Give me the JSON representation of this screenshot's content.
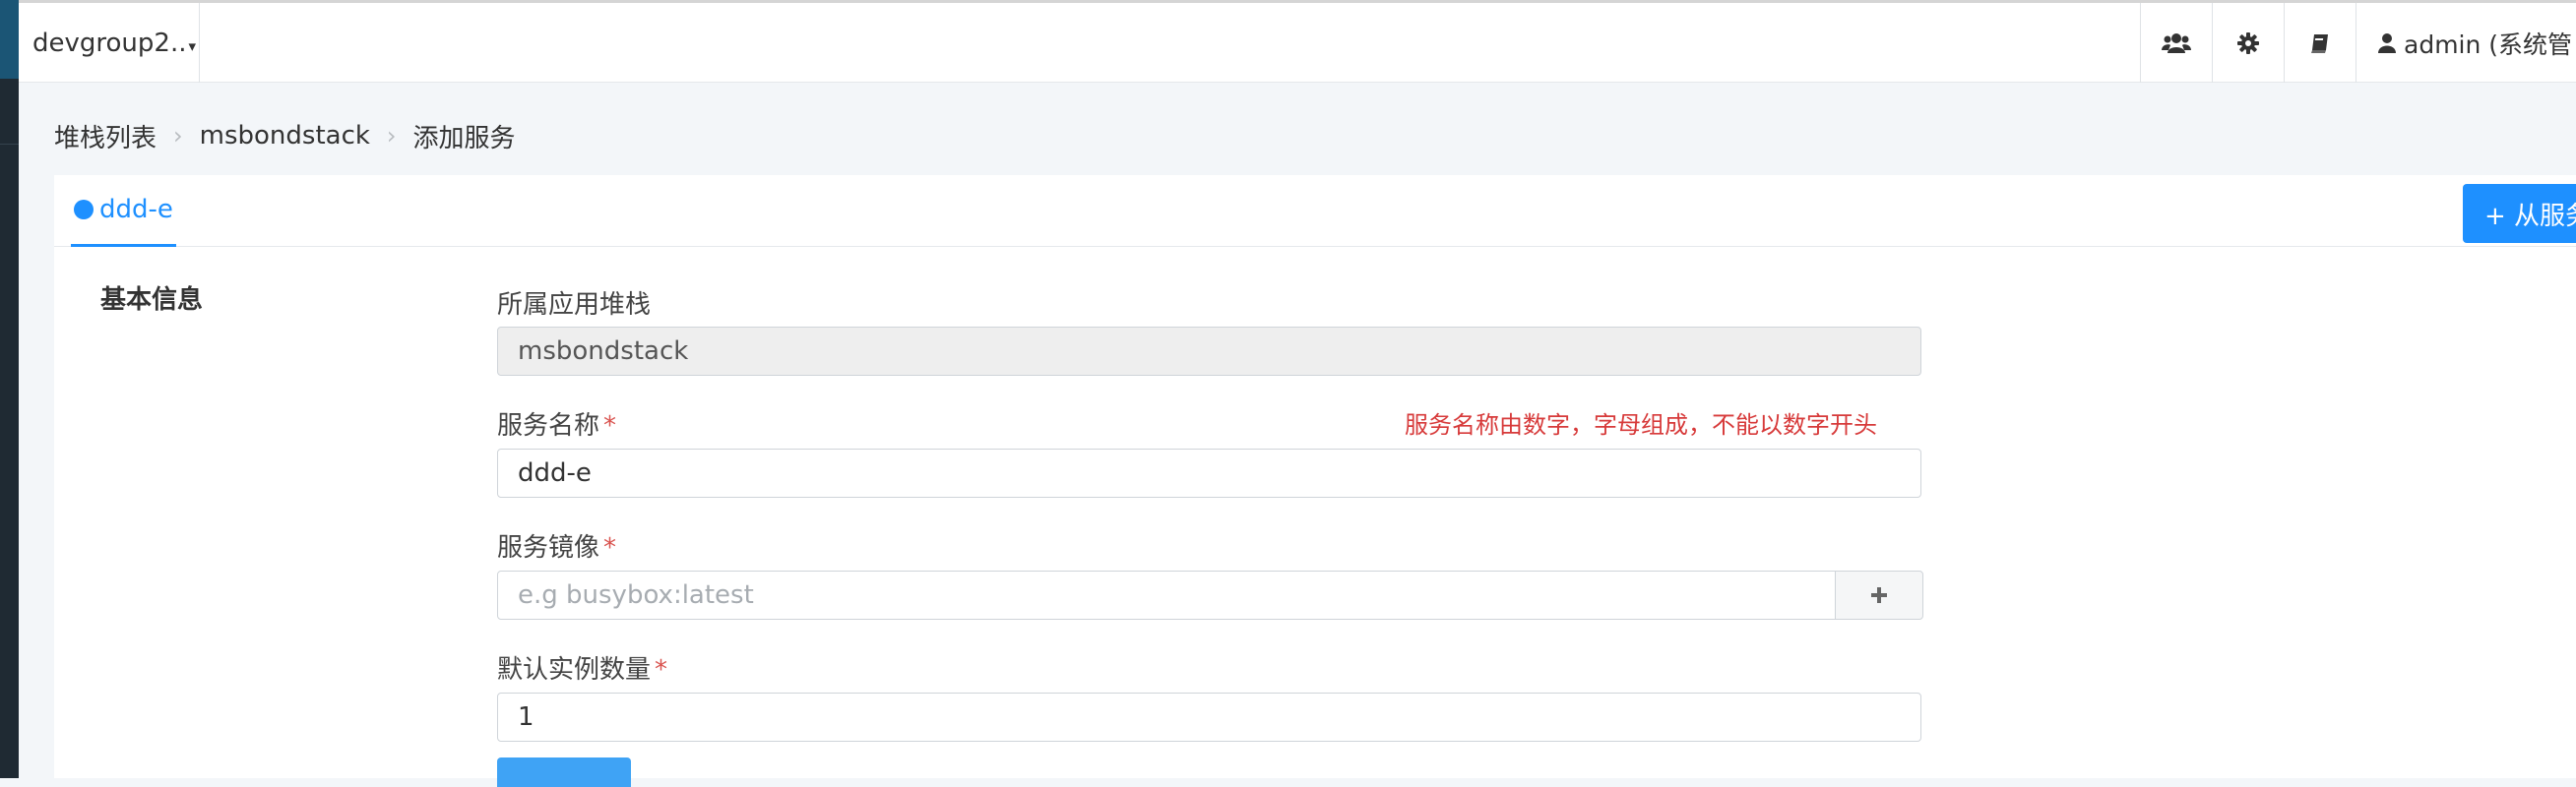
{
  "topbar": {
    "group_select": "devgroup2..",
    "icons": [
      "users-icon",
      "gear-icon",
      "book-icon"
    ],
    "user_label": "admin (系统管"
  },
  "breadcrumb": {
    "items": [
      "堆栈列表",
      "msbondstack",
      "添加服务"
    ]
  },
  "tabs": {
    "active": "ddd-e",
    "add_button": "+ 从服务"
  },
  "form": {
    "section_title": "基本信息",
    "stack": {
      "label": "所属应用堆栈",
      "value": "msbondstack"
    },
    "service_name": {
      "label": "服务名称",
      "required": "*",
      "value": "ddd-e",
      "error": "服务名称由数字，字母组成，不能以数字开头"
    },
    "service_image": {
      "label": "服务镜像",
      "required": "*",
      "placeholder": "e.g busybox:latest",
      "addon": "+"
    },
    "instance_count": {
      "label": "默认实例数量",
      "required": "*",
      "value": "1"
    }
  },
  "colors": {
    "primary": "#1e90ff",
    "error": "#d73a3a",
    "sidebar": "#1f2a33"
  }
}
